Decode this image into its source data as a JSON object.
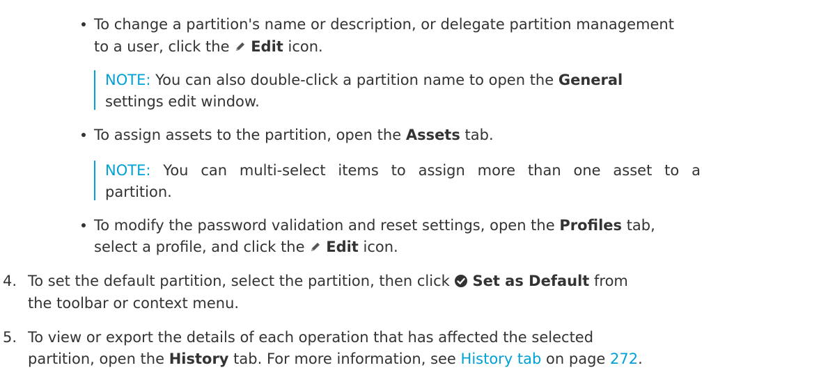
{
  "bullets": [
    {
      "lines": [
        {
          "pre": "To change a partition's name or description, or delegate partition management",
          "bold": "",
          "post": ""
        },
        {
          "pre": "to a user, click the ",
          "icon": "pencil-icon",
          "bold": "Edit",
          "post": " icon."
        }
      ],
      "note": {
        "label": "NOTE:",
        "lines": [
          {
            "pre": " You can also double-click a partition name to open the ",
            "bold": "General",
            "post": ""
          },
          {
            "pre": "settings edit window.",
            "bold": "",
            "post": ""
          }
        ]
      }
    },
    {
      "lines": [
        {
          "pre": "To assign assets to the partition, open the ",
          "bold": "Assets",
          "post": " tab."
        }
      ],
      "note": {
        "label": "NOTE:",
        "lines": [
          {
            "pre": " You can multi-select items to assign more than one asset to a",
            "bold": "",
            "post": ""
          },
          {
            "pre": "partition.",
            "bold": "",
            "post": ""
          }
        ]
      }
    },
    {
      "lines": [
        {
          "pre": "To modify the password validation and reset settings, open the ",
          "bold": "Profiles",
          "post": " tab,"
        },
        {
          "pre": "select a profile, and click the ",
          "icon": "pencil-icon",
          "bold": "Edit",
          "post": " icon."
        }
      ]
    }
  ],
  "steps": [
    {
      "number": "4.",
      "line1_pre": "To set the default partition, select the partition, then click ",
      "line1_icon": "check-circle-icon",
      "line1_bold": "Set as Default",
      "line1_post": " from",
      "line2": "the toolbar or context menu."
    },
    {
      "number": "5.",
      "line1": "To view or export the details of each operation that has affected the selected",
      "line2_pre": "partition, open the ",
      "line2_bold": "History",
      "line2_mid": " tab. For more information, see ",
      "line2_link": "History tab",
      "line2_mid2": " on page ",
      "line2_page": "272",
      "line2_end": "."
    }
  ]
}
